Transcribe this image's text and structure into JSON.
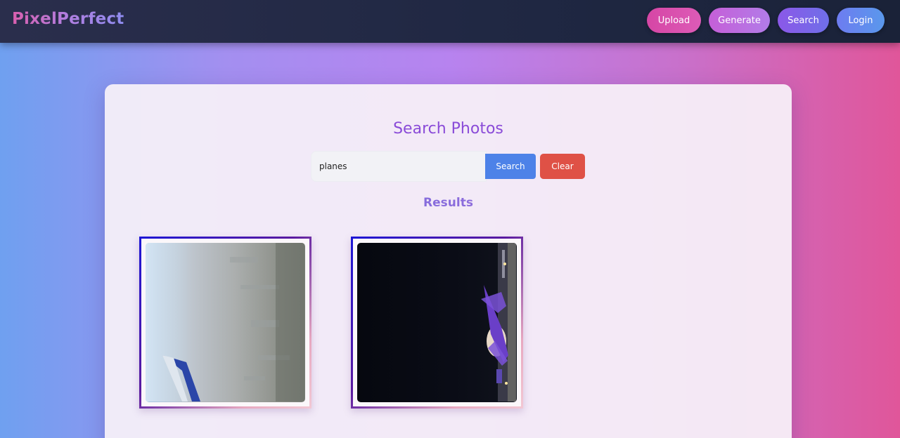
{
  "app": {
    "brand": "PixelPerfect"
  },
  "nav": {
    "upload": "Upload",
    "generate": "Generate",
    "search": "Search",
    "login": "Login"
  },
  "search_page": {
    "title": "Search Photos",
    "query_value": "planes",
    "search_button": "Search",
    "clear_button": "Clear",
    "results_heading": "Results"
  },
  "results": [
    {
      "alt": "Aerial view from airplane window with wing"
    },
    {
      "alt": "Airplane at night on tarmac"
    }
  ],
  "colors": {
    "search_button": "#4d82e8",
    "clear_button": "#df5146",
    "title": "#8a4bd8"
  }
}
